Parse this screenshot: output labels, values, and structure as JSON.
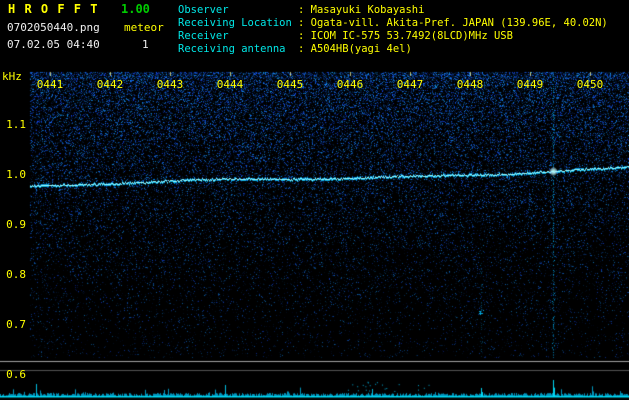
{
  "app": {
    "title": "H R O F F T",
    "version": "1.00"
  },
  "file": {
    "name": "0702050440.png",
    "datetime": "07.02.05 04:40"
  },
  "meteor": {
    "label": "meteor",
    "count": "1"
  },
  "info": {
    "rows": [
      {
        "label": "Observer",
        "value": ": Masayuki Kobayashi"
      },
      {
        "label": "Receiving Location",
        "value": ": Ogata-vill. Akita-Pref. JAPAN (139.96E, 40.02N)"
      },
      {
        "label": "Receiver",
        "value": ": ICOM IC-575 53.7492(8LCD)MHz USB"
      },
      {
        "label": "Receiving antenna",
        "value": ": A504HB(yagi 4el)"
      }
    ]
  },
  "chart_data": {
    "type": "heatmap",
    "subtype": "radio-meteor-spectrogram",
    "x_axis": {
      "ticks": [
        "0441",
        "0442",
        "0443",
        "0444",
        "0445",
        "0446",
        "0447",
        "0448",
        "0449",
        "0450"
      ]
    },
    "y_axis": {
      "unit": "kHz",
      "ticks": [
        "1.1",
        "1.0",
        "0.9",
        "0.8",
        "0.7",
        "0.6"
      ],
      "tick_values": [
        1.1,
        1.0,
        0.9,
        0.8,
        0.7,
        0.6
      ]
    },
    "carrier_trace": {
      "start_khz": 0.976,
      "end_khz": 1.012,
      "color": "#99ffff"
    },
    "events": [
      {
        "time": "0449",
        "type": "meteor-echo",
        "strength": "strong",
        "x_frac": 0.873
      },
      {
        "time": "0448",
        "type": "meteor-echo",
        "strength": "faint",
        "x_frac": 0.753
      }
    ],
    "noise_palette": [
      "#000000",
      "#0030a0",
      "#0060ff",
      "#00c0ff"
    ],
    "panels": [
      "spectrogram",
      "signal-level-strip"
    ],
    "background": "#000000"
  }
}
